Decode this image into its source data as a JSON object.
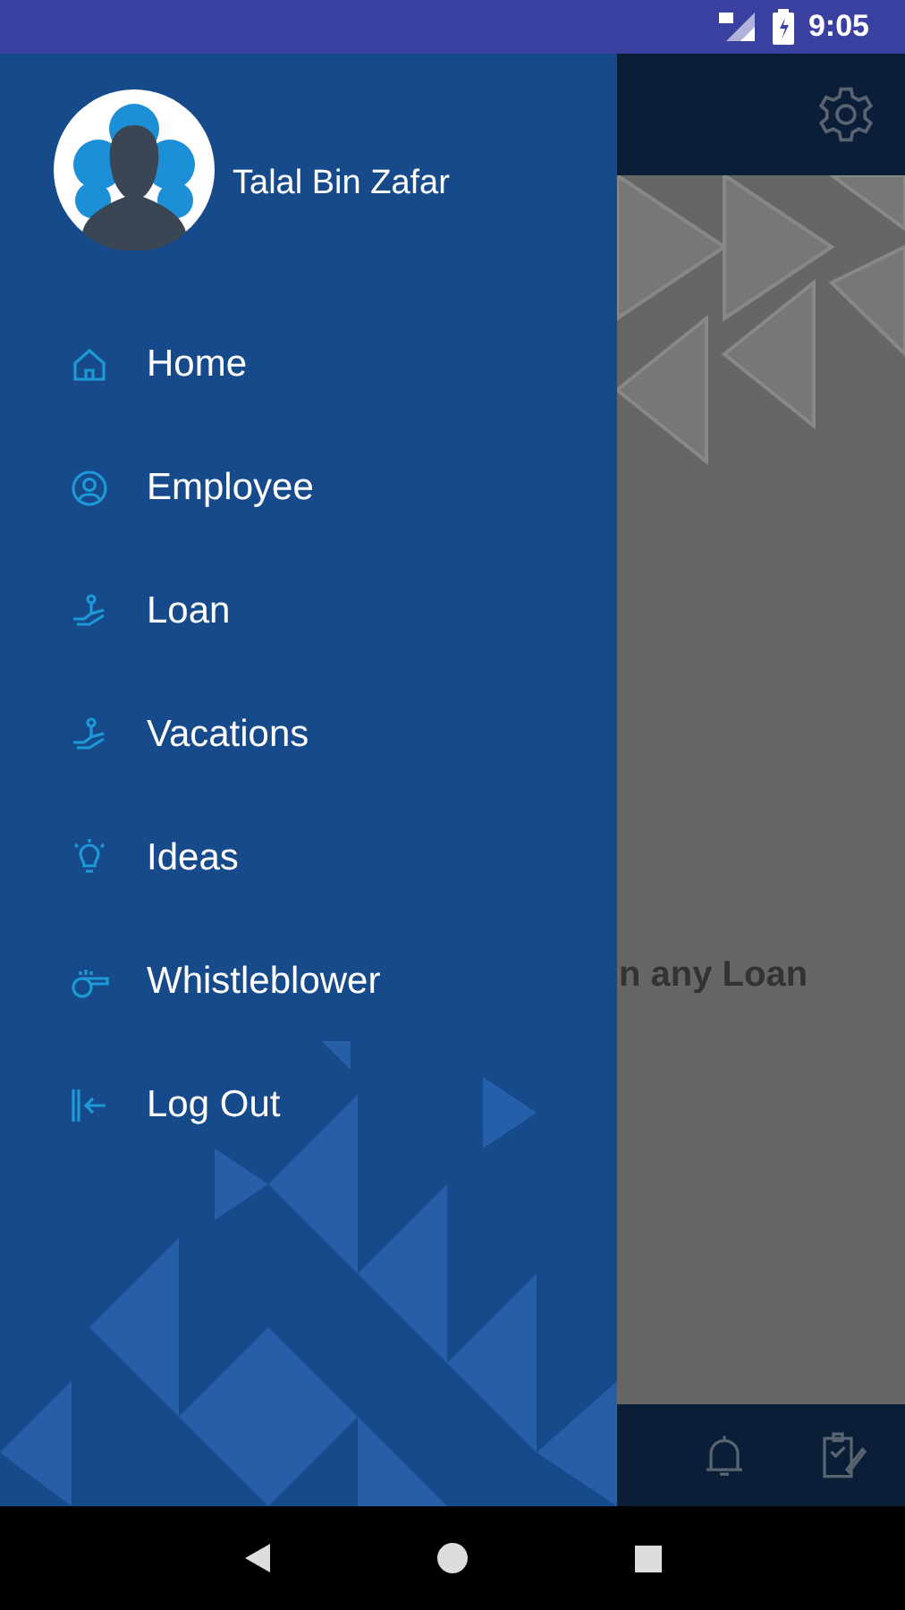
{
  "status_bar": {
    "time": "9:05"
  },
  "drawer": {
    "user_name": "Talal Bin Zafar",
    "items": [
      {
        "label": "Home",
        "kind": "home"
      },
      {
        "label": "Employee",
        "kind": "person"
      },
      {
        "label": "Loan",
        "kind": "hand"
      },
      {
        "label": "Vacations",
        "kind": "hand"
      },
      {
        "label": "Ideas",
        "kind": "bulb"
      },
      {
        "label": "Whistleblower",
        "kind": "whistle"
      },
      {
        "label": "Log Out",
        "kind": "logout"
      }
    ]
  },
  "content": {
    "message": "n any Loan"
  }
}
